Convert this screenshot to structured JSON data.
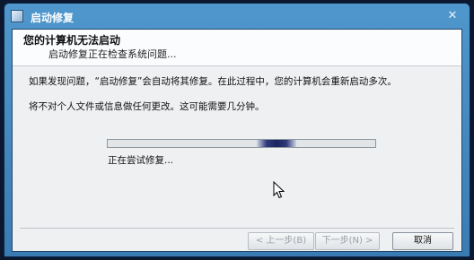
{
  "window": {
    "title": "启动修复"
  },
  "header": {
    "heading": "您的计算机无法启动",
    "subheading": "启动修复正在检查系统问题..."
  },
  "body": {
    "paragraph1": "如果发现问题，“启动修复”会自动将其修复。在此过程中，您的计算机会重新启动多次。",
    "paragraph2": "将不对个人文件或信息做任何更改。这可能需要几分钟。"
  },
  "progress": {
    "type": "marquee",
    "position_fraction": 0.63
  },
  "status": {
    "text": "正在尝试修复..."
  },
  "buttons": {
    "back": "< 上一步(B)",
    "next": "下一步(N) >",
    "cancel": "取消"
  },
  "icons": {
    "close": "close-icon",
    "app": "startup-repair-icon",
    "cursor": "mouse-pointer-icon"
  }
}
